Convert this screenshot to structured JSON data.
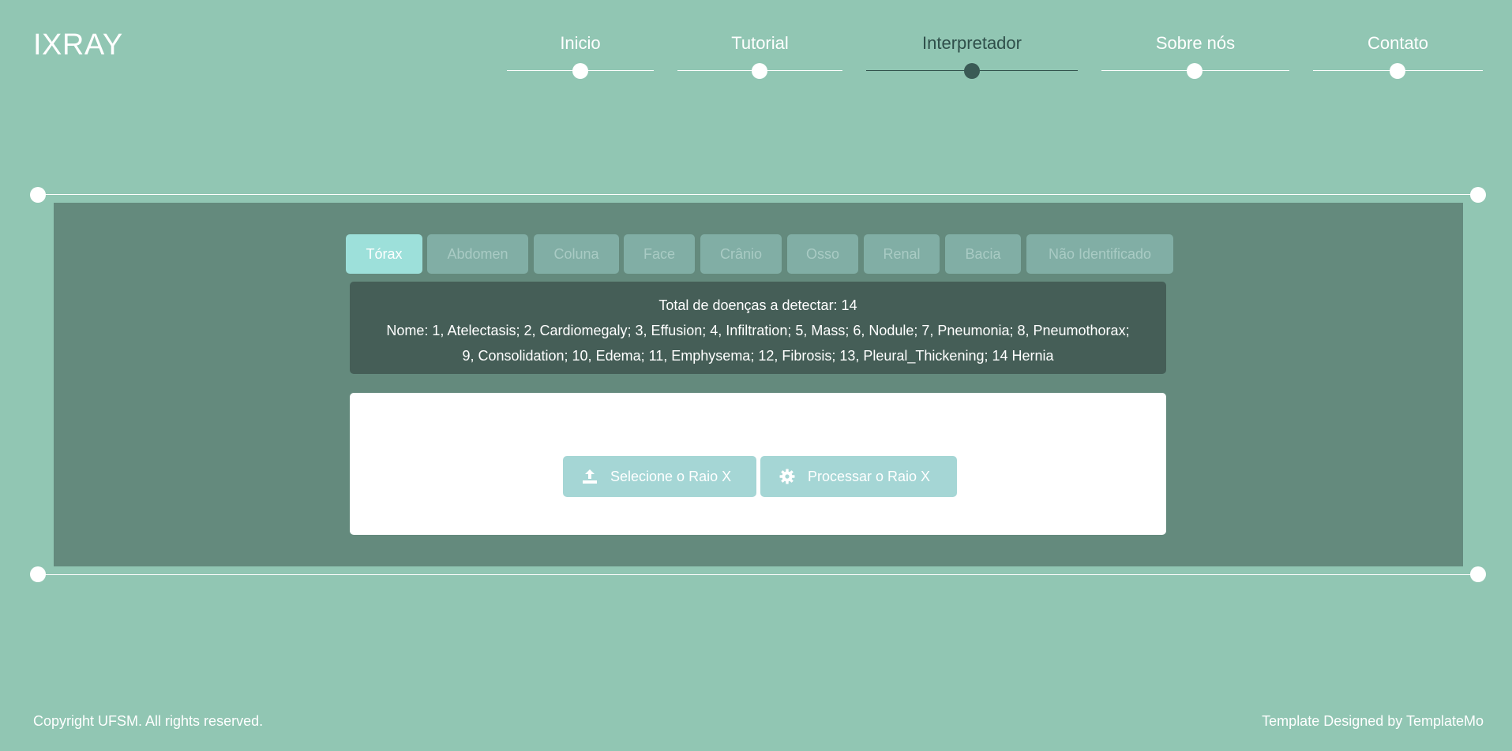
{
  "brand": {
    "logo": "IXRAY"
  },
  "nav": {
    "items": [
      {
        "label": "Inicio"
      },
      {
        "label": "Tutorial"
      },
      {
        "label": "Interpretador",
        "active": true
      },
      {
        "label": "Sobre nós"
      },
      {
        "label": "Contato"
      }
    ]
  },
  "tabs": [
    {
      "label": "Tórax",
      "active": true
    },
    {
      "label": "Abdomen"
    },
    {
      "label": "Coluna"
    },
    {
      "label": "Face"
    },
    {
      "label": "Crânio"
    },
    {
      "label": "Osso"
    },
    {
      "label": "Renal"
    },
    {
      "label": "Bacia"
    },
    {
      "label": "Não Identificado"
    }
  ],
  "info": {
    "total": "Total de doenças a detectar: 14",
    "names_line1": "Nome: 1, Atelectasis; 2, Cardiomegaly; 3, Effusion; 4, Infiltration; 5, Mass; 6, Nodule; 7, Pneumonia; 8, Pneumothorax;",
    "names_line2": "9, Consolidation; 10, Edema; 11, Emphysema; 12, Fibrosis; 13, Pleural_Thickening; 14 Hernia"
  },
  "upload": {
    "select_label": "Selecione o Raio X",
    "select_icon": "upload-icon",
    "process_label": "Processar o Raio X",
    "process_icon": "gear-icon"
  },
  "footer": {
    "copyright": "Copyright UFSM. All rights reserved.",
    "credit": "Template Designed by TemplateMo"
  },
  "colors": {
    "background": "#91c6b3",
    "panel": "#648a7d",
    "info_box": "#455e57",
    "active_tab": "#9de0da",
    "button": "#a5d6d5"
  }
}
